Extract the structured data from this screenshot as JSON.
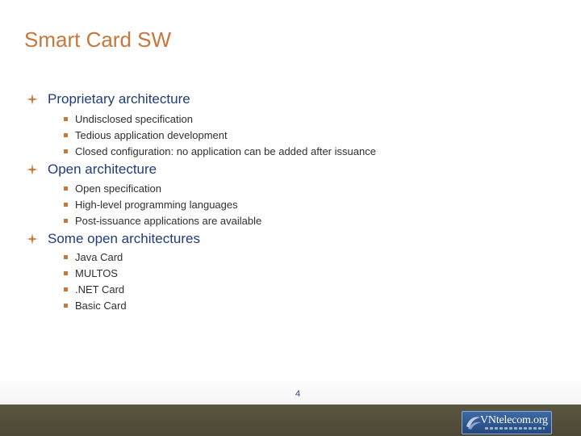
{
  "slide": {
    "title": "Smart Card SW",
    "page_number": "4"
  },
  "sections": [
    {
      "heading": "Proprietary architecture",
      "items": [
        "Undisclosed specification",
        "Tedious application development",
        "Closed configuration: no application can be added after issuance"
      ]
    },
    {
      "heading": "Open architecture",
      "items": [
        "Open specification",
        "High-level programming languages",
        "Post-issuance applications are available"
      ]
    },
    {
      "heading": "Some open architectures",
      "items": [
        "Java Card",
        "MULTOS",
        ".NET Card",
        "Basic Card"
      ]
    }
  ],
  "footer": {
    "logo_text": "VNtelecom.org"
  },
  "colors": {
    "title": "#c8763a",
    "heading": "#1f3d7a",
    "bullet": "#c8763a",
    "footer_bar": "#4c4836"
  }
}
